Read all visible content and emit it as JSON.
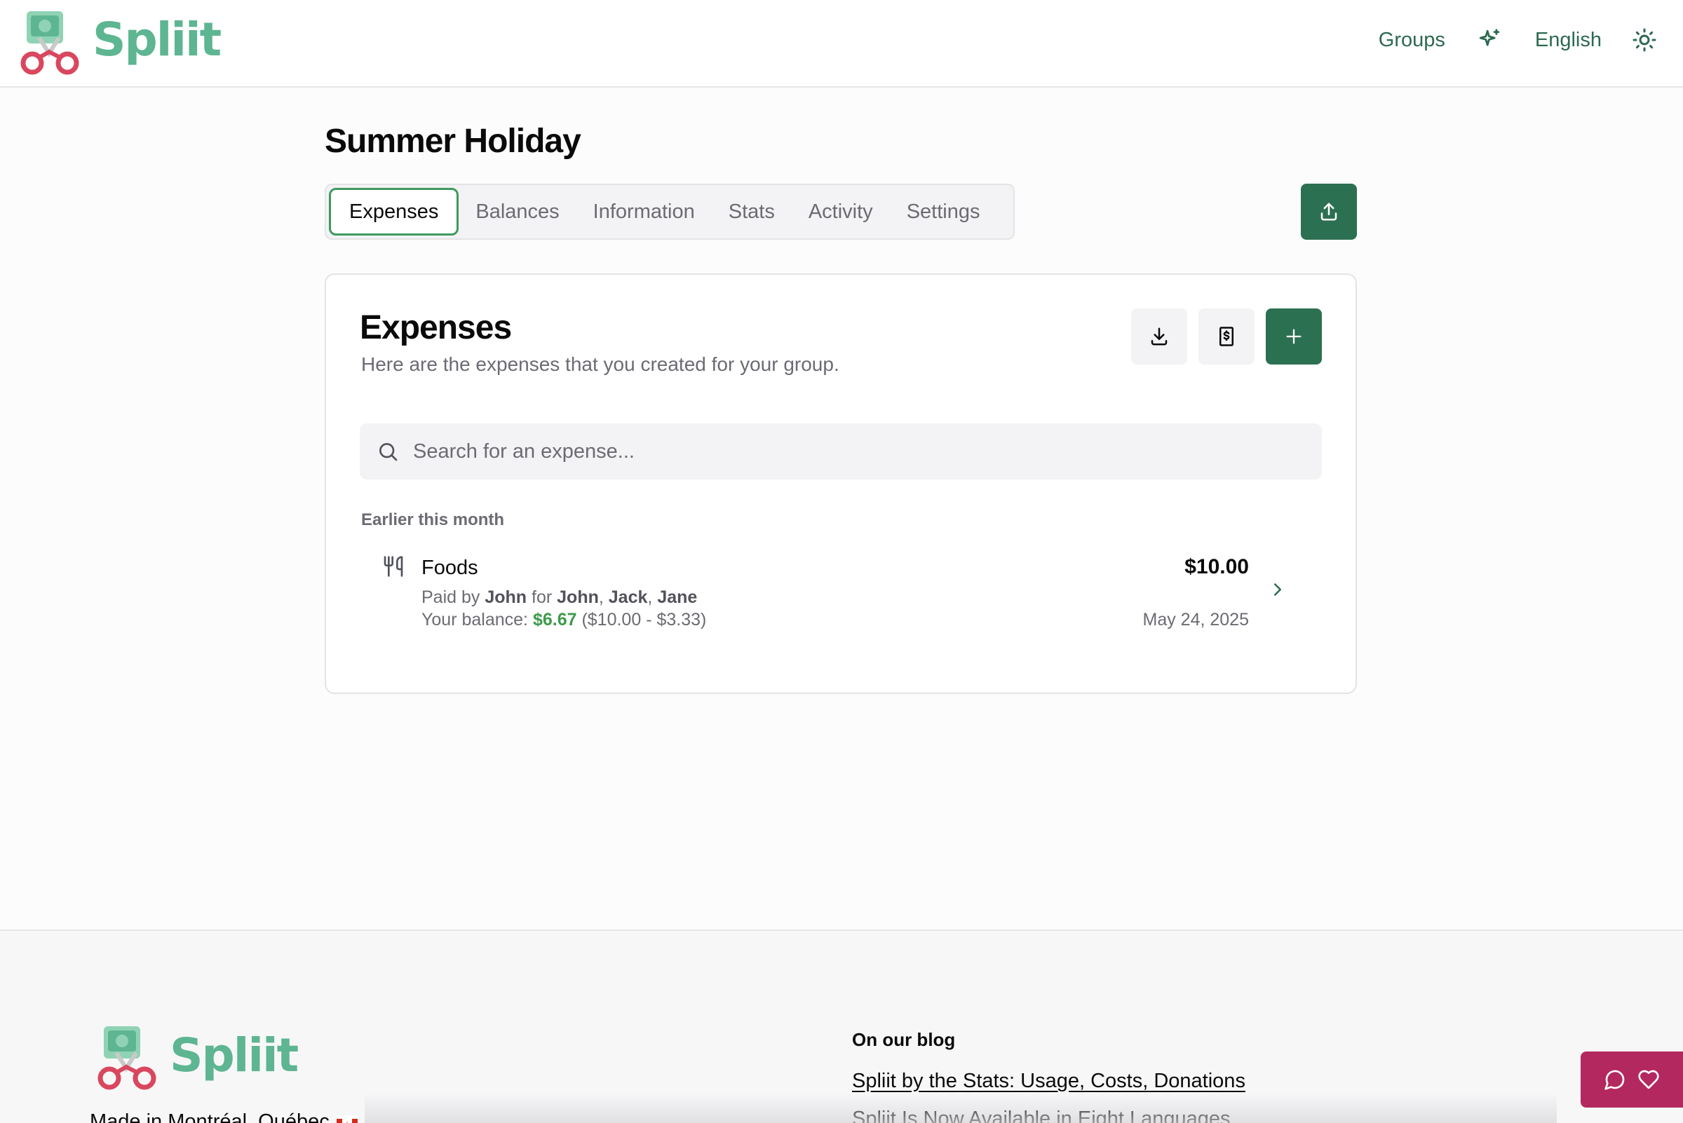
{
  "header": {
    "logo_text": "Spliit",
    "nav": {
      "groups_label": "Groups",
      "language_label": "English"
    },
    "icons": [
      "sparkles-icon",
      "sun-icon"
    ]
  },
  "group": {
    "title": "Summer Holiday",
    "tabs": [
      {
        "label": "Expenses",
        "active": true
      },
      {
        "label": "Balances",
        "active": false
      },
      {
        "label": "Information",
        "active": false
      },
      {
        "label": "Stats",
        "active": false
      },
      {
        "label": "Activity",
        "active": false
      },
      {
        "label": "Settings",
        "active": false
      }
    ]
  },
  "expenses_card": {
    "title": "Expenses",
    "subtitle": "Here are the expenses that you created for your group.",
    "search_placeholder": "Search for an expense...",
    "group_label": "Earlier this month",
    "items": [
      {
        "icon": "fork-knife-icon",
        "title": "Foods",
        "paid_prefix": "Paid by",
        "payer": "John",
        "for_word": "for",
        "participants": [
          "John",
          "Jack",
          "Jane"
        ],
        "balance_prefix": "Your balance:",
        "balance": "$6.67",
        "balance_detail": "($10.00 - $3.33)",
        "amount": "$10.00",
        "date": "May 24, 2025"
      }
    ]
  },
  "footer": {
    "logo_text": "Spliit",
    "made_in": "Made in Montréal, Québec",
    "blog_heading": "On our blog",
    "blog_links": [
      "Spliit by the Stats: Usage, Costs, Donations",
      "Spliit Is Now Available in Eight Languages"
    ]
  },
  "colors": {
    "brand": "#2c7052",
    "brand_light": "#5eb592",
    "positive": "#3e9a4a",
    "feedback": "#b3285e"
  }
}
